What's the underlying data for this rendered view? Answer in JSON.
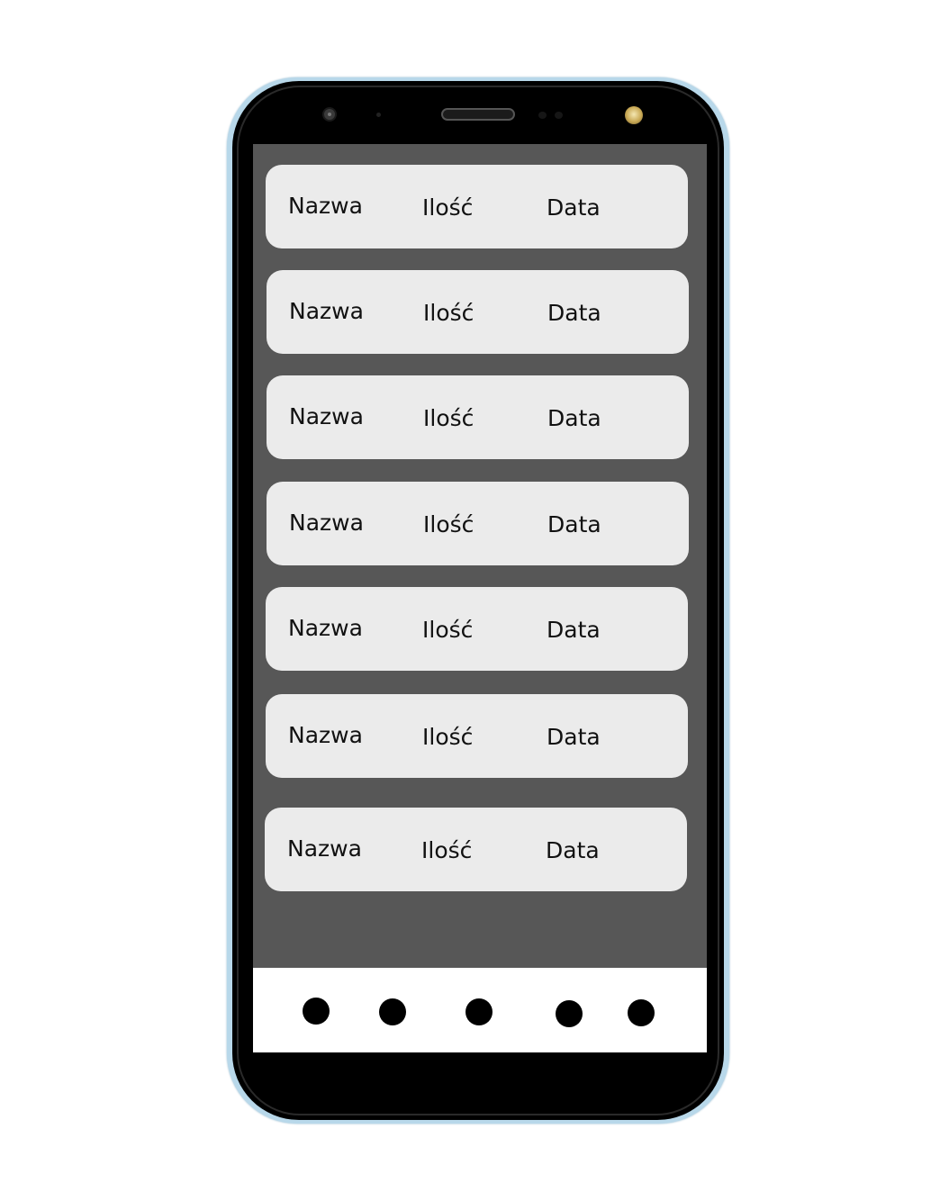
{
  "list": {
    "rows": [
      {
        "name": "Nazwa",
        "qty": "Ilość",
        "date": "Data"
      },
      {
        "name": "Nazwa",
        "qty": "Ilość",
        "date": "Data"
      },
      {
        "name": "Nazwa",
        "qty": "Ilość",
        "date": "Data"
      },
      {
        "name": "Nazwa",
        "qty": "Ilość",
        "date": "Data"
      },
      {
        "name": "Nazwa",
        "qty": "Ilość",
        "date": "Data"
      },
      {
        "name": "Nazwa",
        "qty": "Ilość",
        "date": "Data"
      },
      {
        "name": "Nazwa",
        "qty": "Ilość",
        "date": "Data"
      }
    ]
  },
  "bottom_nav": {
    "items": [
      "nav-dot-icon",
      "nav-dot-icon",
      "nav-dot-icon",
      "nav-dot-icon",
      "nav-dot-icon"
    ]
  },
  "colors": {
    "screen_background": "#575757",
    "row_background": "#ebebeb",
    "nav_background": "#ffffff",
    "phone_frame": "#b8d8ea"
  }
}
